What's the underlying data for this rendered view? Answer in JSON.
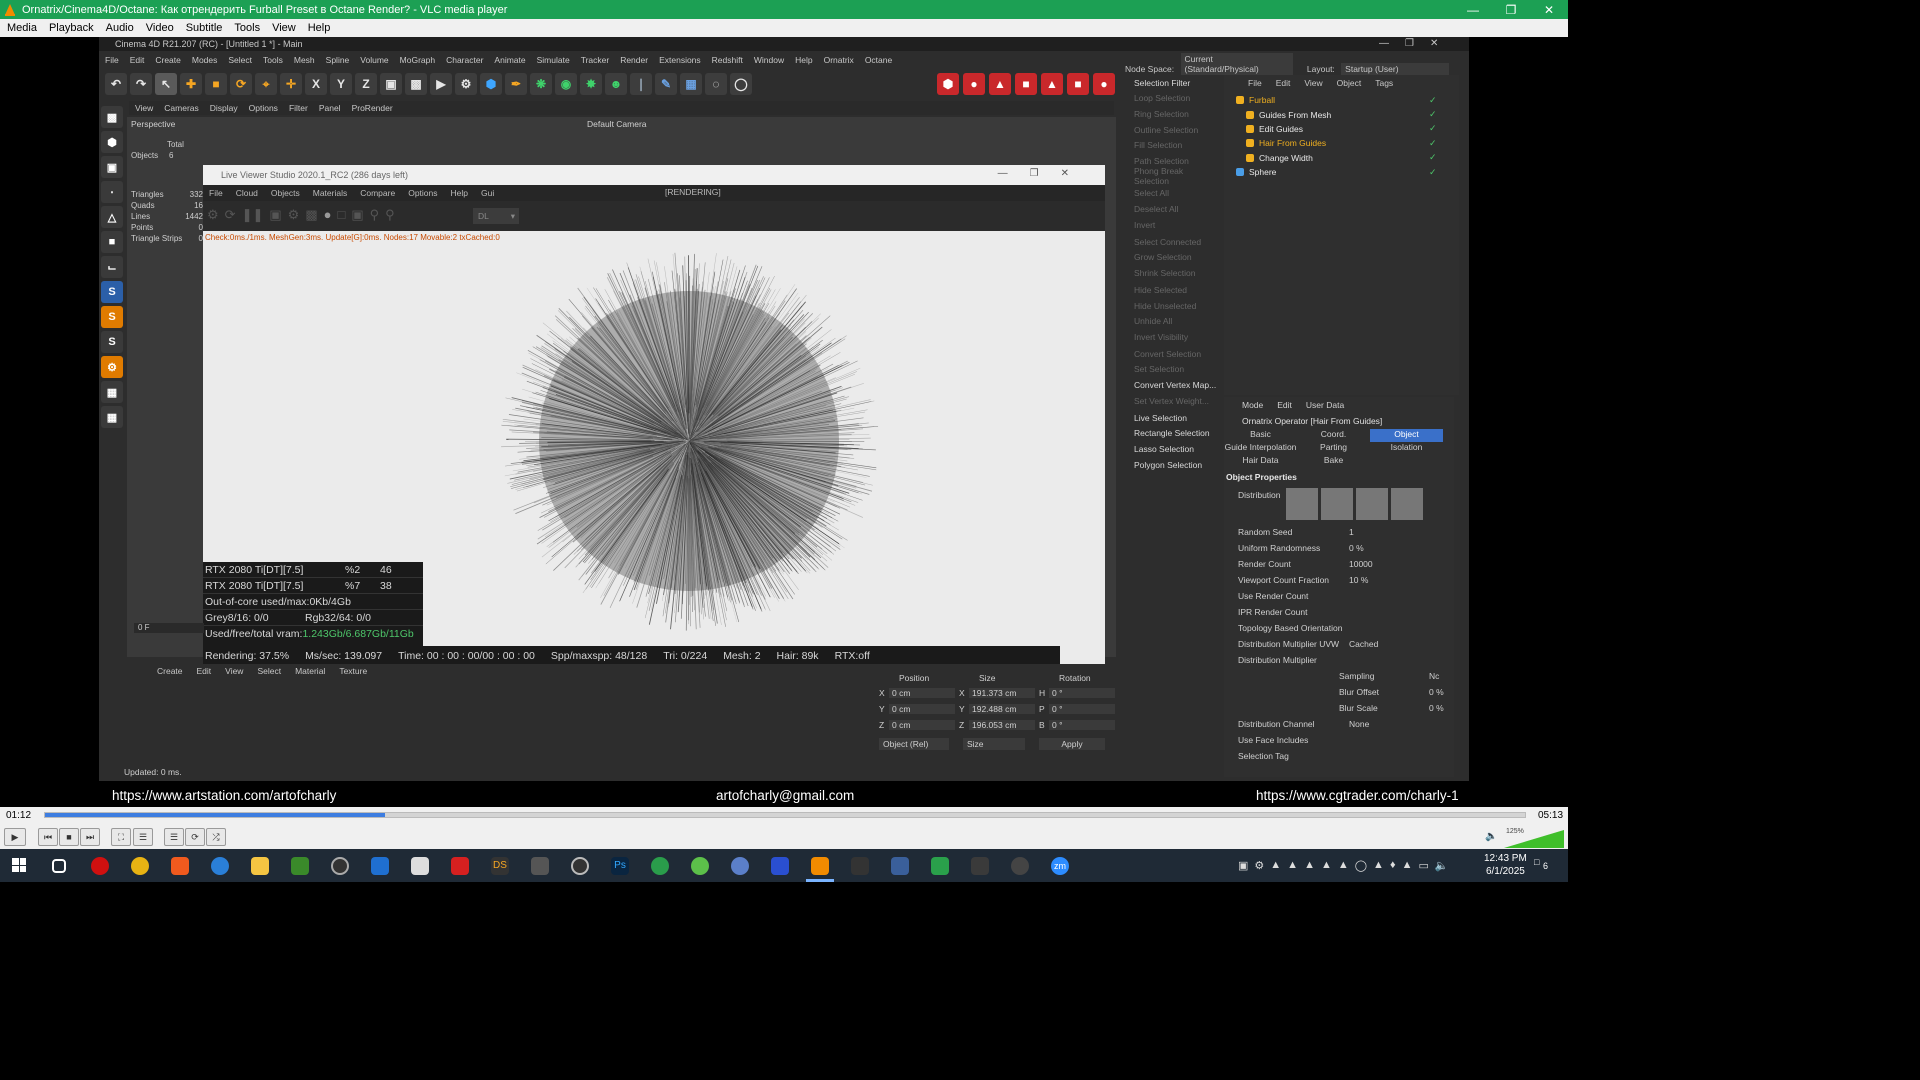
{
  "vlc": {
    "title": "Ornatrix/Cinema4D/Octane: Как отрендерить Furball Preset в Octane Render? - VLC media player",
    "menu": [
      "Media",
      "Playback",
      "Audio",
      "Video",
      "Subtitle",
      "Tools",
      "View",
      "Help"
    ],
    "time_elapsed": "01:12",
    "time_total": "05:13",
    "progress": 0.23,
    "volume": "125%",
    "urls": {
      "left": "https://www.artstation.com/artofcharly",
      "center": "artofcharly@gmail.com",
      "right": "https://www.cgtrader.com/charly-1"
    }
  },
  "c4d": {
    "title": "Cinema 4D R21.207 (RC) - [Untitled 1 *] - Main",
    "menu": [
      "File",
      "Edit",
      "Create",
      "Modes",
      "Select",
      "Tools",
      "Mesh",
      "Spline",
      "Volume",
      "MoGraph",
      "Character",
      "Animate",
      "Simulate",
      "Tracker",
      "Render",
      "Extensions",
      "Redshift",
      "Window",
      "Help",
      "Ornatrix",
      "Octane"
    ],
    "node_space_label": "Node Space:",
    "node_space_value": "Current (Standard/Physical)",
    "layout_label": "Layout:",
    "layout_value": "Startup (User)",
    "viewport_menu": [
      "View",
      "Cameras",
      "Display",
      "Options",
      "Filter",
      "Panel",
      "ProRender"
    ],
    "viewport_label": "Perspective",
    "camera_label": "Default Camera",
    "stats": {
      "total_label": "Total",
      "objects_label": "Objects",
      "objects": "6",
      "triangles_label": "Triangles",
      "triangles": "332",
      "quads_label": "Quads",
      "quads": "16",
      "lines_label": "Lines",
      "lines": "1442",
      "points_label": "Points",
      "points": "0",
      "strips_label": "Triangle Strips",
      "strips": "0"
    },
    "selection": [
      "Selection Filter",
      "Loop Selection",
      "Ring Selection",
      "Outline Selection",
      "Fill Selection",
      "Path Selection",
      "Phong Break Selection",
      "Select All",
      "Deselect All",
      "Invert",
      "Select Connected",
      "Grow Selection",
      "Shrink Selection",
      "Hide Selected",
      "Hide Unselected",
      "Unhide All",
      "Invert Visibility",
      "Convert Selection",
      "Set Selection",
      "Convert Vertex Map...",
      "Set Vertex Weight...",
      "Live Selection",
      "Rectangle Selection",
      "Lasso Selection",
      "Polygon Selection"
    ],
    "objects_menu": [
      "File",
      "Edit",
      "View",
      "Object",
      "Tags"
    ],
    "objects": [
      {
        "name": "Furball",
        "color": "#f0b020"
      },
      {
        "name": "Guides From Mesh",
        "color": "#e8e8e8"
      },
      {
        "name": "Edit Guides",
        "color": "#e8e8e8"
      },
      {
        "name": "Hair From Guides",
        "color": "#f0b020"
      },
      {
        "name": "Change Width",
        "color": "#e8e8e8"
      },
      {
        "name": "Sphere",
        "color": "#e8e8e8"
      }
    ],
    "attr_menu": [
      "Mode",
      "Edit",
      "User Data"
    ],
    "attr_title": "Ornatrix Operator [Hair From Guides]",
    "attr_tabs": [
      "Basic",
      "Coord.",
      "Object",
      "Guide Interpolation",
      "Parting",
      "Isolation",
      "Hair Data",
      "Bake"
    ],
    "section": "Object Properties",
    "distribution_label": "Distribution",
    "props": [
      {
        "label": "Random Seed",
        "value": "1"
      },
      {
        "label": "Uniform Randomness",
        "value": "0 %"
      },
      {
        "label": "Render Count",
        "value": "10000"
      },
      {
        "label": "Viewport Count Fraction",
        "value": "10 %"
      },
      {
        "label": "Use Render Count",
        "value": ""
      },
      {
        "label": "IPR Render Count",
        "value": ""
      },
      {
        "label": "Topology Based Orientation",
        "value": ""
      },
      {
        "label": "Distribution Multiplier UVW",
        "value": "Cached"
      },
      {
        "label": "Distribution Multiplier",
        "value": ""
      },
      {
        "label": "Sampling",
        "value": "Nc"
      },
      {
        "label": "Blur Offset",
        "value": "0 %"
      },
      {
        "label": "Blur Scale",
        "value": "0 %"
      },
      {
        "label": "Distribution Channel",
        "value": "None"
      },
      {
        "label": "Use Face Includes",
        "value": ""
      },
      {
        "label": "Selection Tag",
        "value": ""
      }
    ],
    "coords": {
      "headers": [
        "Position",
        "Size",
        "Rotation"
      ],
      "rows": [
        [
          "X",
          "0 cm",
          "X",
          "191.373 cm",
          "H",
          "0 °"
        ],
        [
          "Y",
          "0 cm",
          "Y",
          "192.488 cm",
          "P",
          "0 °"
        ],
        [
          "Z",
          "0 cm",
          "Z",
          "196.053 cm",
          "B",
          "0 °"
        ]
      ],
      "mode": "Object (Rel)",
      "size_mode": "Size",
      "apply": "Apply"
    },
    "material_menu": [
      "Create",
      "Edit",
      "View",
      "Select",
      "Material",
      "Texture"
    ],
    "status": "Updated: 0 ms.",
    "timeline_frame": "0 F"
  },
  "lv": {
    "title": "Live Viewer Studio 2020.1_RC2 (286 days left)",
    "menu": [
      "File",
      "Cloud",
      "Objects",
      "Materials",
      "Compare",
      "Options",
      "Help",
      "Gui"
    ],
    "state": "[RENDERING]",
    "dropdown": "DL",
    "check": "Check:0ms./1ms. MeshGen:3ms. Update[G]:0ms. Nodes:17 Movable:2 txCached:0",
    "gpu": [
      [
        "RTX 2080 Ti[DT][7.5]",
        "%2",
        "46"
      ],
      [
        "RTX 2080 Ti[DT][7.5]",
        "%7",
        "38"
      ]
    ],
    "ooc": "Out-of-core used/max:0Kb/4Gb",
    "grey": "Grey8/16: 0/0",
    "rgb": "Rgb32/64: 0/0",
    "vram_label": "Used/free/total vram: ",
    "vram": "1.243Gb/6.687Gb/11Gb",
    "rendering": "Rendering: 37.5%",
    "ms": "Ms/sec: 139.097",
    "time": "Time: 00 : 00 : 00/00 : 00 : 00",
    "spp": "Spp/maxspp: 48/128",
    "tri": "Tri: 0/224",
    "mesh": "Mesh: 2",
    "hair": "Hair: 89k",
    "rtx": "RTX:off",
    "progress": 0.375
  },
  "taskbar": {
    "time": "12:43 PM",
    "date": "6/1/2025",
    "notif": "6"
  }
}
